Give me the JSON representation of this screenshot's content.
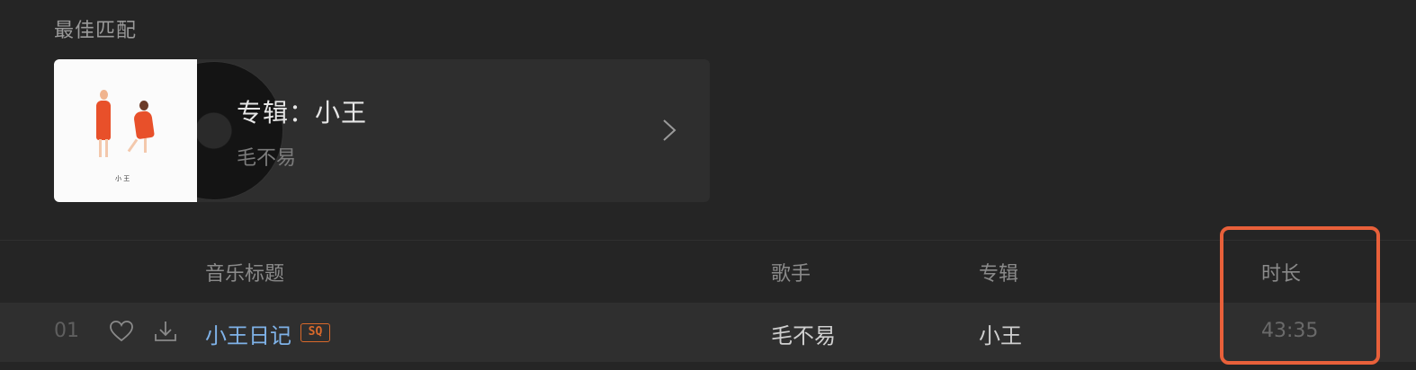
{
  "best_match": {
    "section_title": "最佳匹配",
    "album_title": "专辑：小王",
    "artist": "毛不易",
    "cover_mark": "小 王"
  },
  "table": {
    "headers": {
      "title": "音乐标题",
      "artist": "歌手",
      "album": "专辑",
      "duration": "时长"
    },
    "rows": [
      {
        "index": "01",
        "title": "小王日记",
        "quality_badge": "SQ",
        "artist": "毛不易",
        "album": "小王",
        "duration": "43:35"
      }
    ]
  },
  "colors": {
    "background": "#252525",
    "song_title": "#7fb2e8",
    "badge": "#d9692b",
    "highlight": "#e8603a"
  },
  "icons": [
    "heart-icon",
    "download-icon",
    "chevron-right-icon"
  ]
}
